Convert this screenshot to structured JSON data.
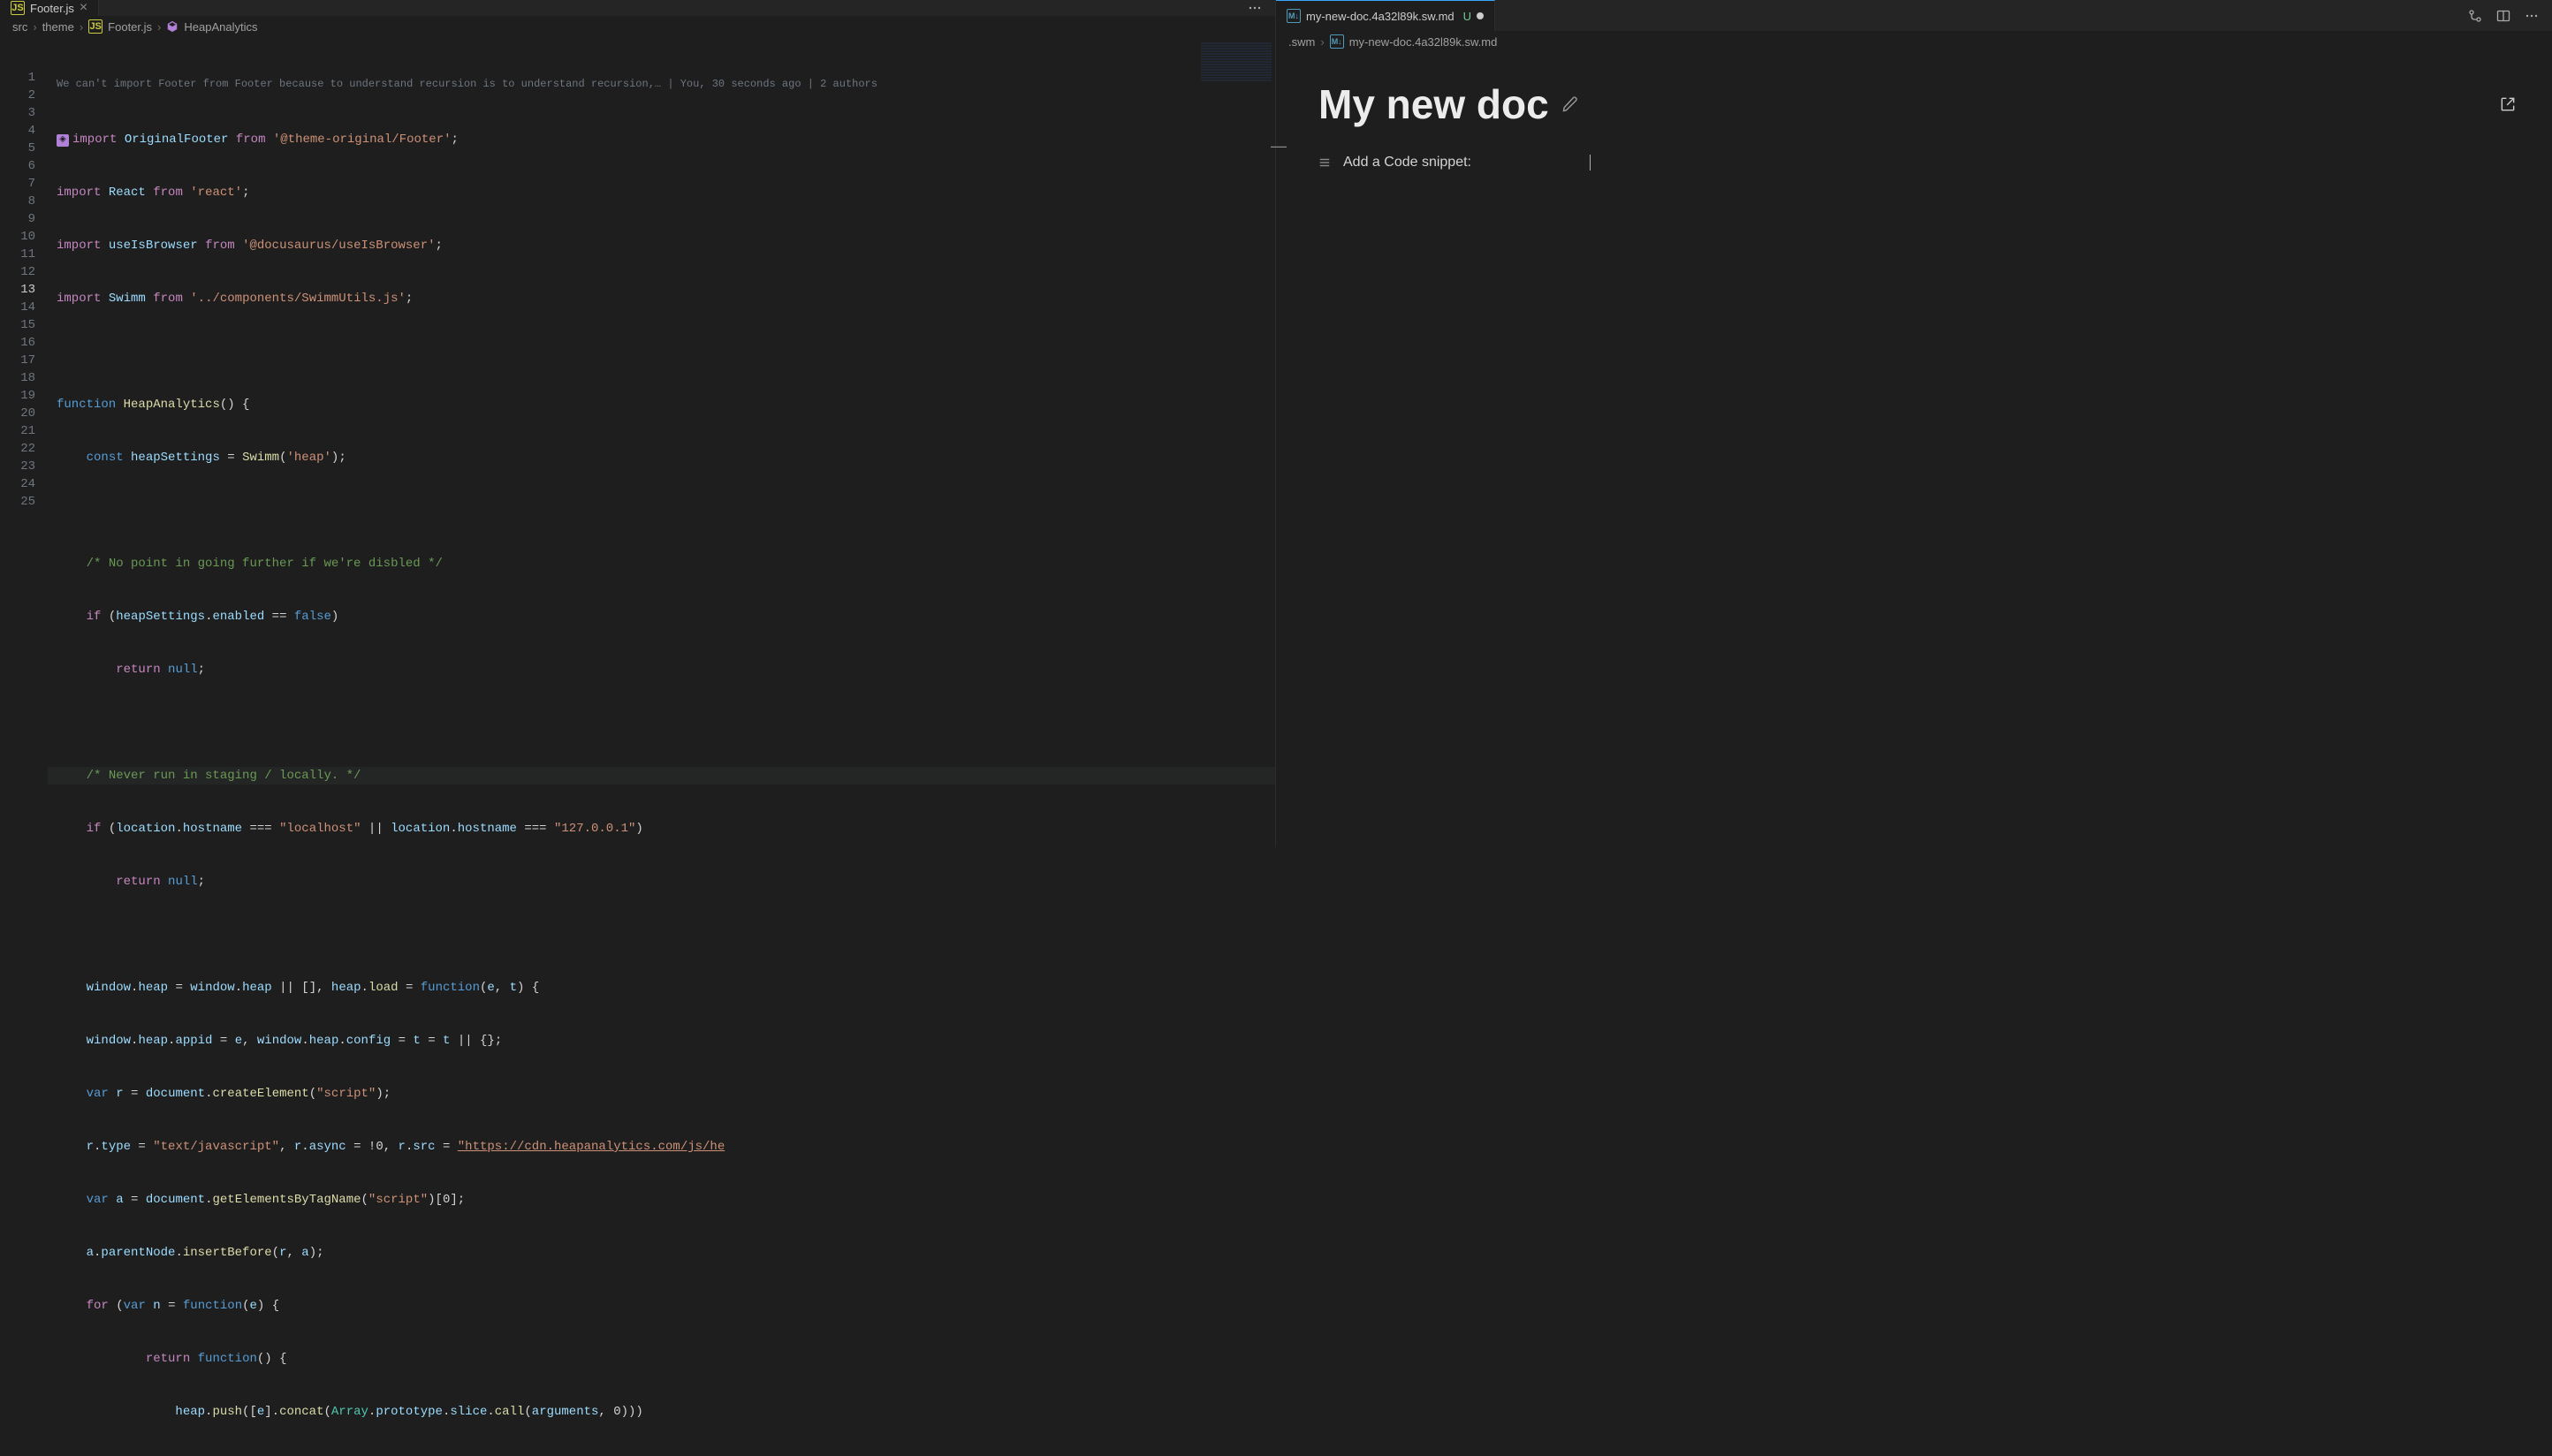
{
  "leftPane": {
    "tab": {
      "icon": "JS",
      "label": "Footer.js"
    },
    "breadcrumbs": {
      "parts": [
        "src",
        "theme"
      ],
      "fileIcon": "JS",
      "file": "Footer.js",
      "symbol": "HeapAnalytics"
    },
    "codelens": "We can't import Footer from Footer because to understand recursion is to understand recursion,… | You, 30 seconds ago | 2 authors",
    "currentLine": 13,
    "lines": 25
  },
  "rightPane": {
    "tab": {
      "icon": "M↓",
      "label": "my-new-doc.4a32l89k.sw.md",
      "u": "U"
    },
    "breadcrumbs": {
      "folder": ".swm",
      "fileIcon": "M↓",
      "file": "my-new-doc.4a32l89k.sw.md"
    },
    "doc": {
      "title": "My new doc",
      "blockText": "Add a Code snippet:"
    }
  },
  "code": {
    "l1": {
      "kw1": "import",
      "v": "OriginalFooter",
      "kw2": "from",
      "s": "'@theme-original/Footer'",
      "t": ";"
    },
    "l2": {
      "kw1": "import",
      "v": "React",
      "kw2": "from",
      "s": "'react'",
      "t": ";"
    },
    "l3": {
      "kw1": "import",
      "v": "useIsBrowser",
      "kw2": "from",
      "s": "'@docusaurus/useIsBrowser'",
      "t": ";"
    },
    "l4": {
      "kw1": "import",
      "v": "Swimm",
      "kw2": "from",
      "s": "'../components/SwimmUtils.js'",
      "t": ";"
    },
    "l6": {
      "kw": "function",
      "fn": "HeapAnalytics",
      "t": "() {"
    },
    "l7": {
      "kw": "const",
      "v": "heapSettings",
      "t1": " = ",
      "fn": "Swimm",
      "t2": "(",
      "s": "'heap'",
      "t3": ");"
    },
    "l9": "/* No point in going further if we're disbled */",
    "l10": {
      "kw": "if",
      "t1": " (",
      "v1": "heapSettings",
      "t2": ".",
      "v2": "enabled",
      "t3": " == ",
      "c": "false",
      "t4": ")"
    },
    "l11": {
      "kw": "return",
      "c": "null",
      "t": ";"
    },
    "l13": "/* Never run in staging / locally. */",
    "l14": {
      "kw": "if",
      "t1": " (",
      "v1": "location",
      "t2": ".",
      "v2": "hostname",
      "t3": " === ",
      "s1": "\"localhost\"",
      "t4": " || ",
      "v3": "location",
      "t5": ".",
      "v4": "hostname",
      "t6": " === ",
      "s2": "\"127.0.0.1\"",
      "t7": ")"
    },
    "l15": {
      "kw": "return",
      "c": "null",
      "t": ";"
    },
    "l17": {
      "v1": "window",
      "t1": ".",
      "v2": "heap",
      "t2": " = ",
      "v3": "window",
      "t3": ".",
      "v4": "heap",
      "t4": " || [], ",
      "v5": "heap",
      "t5": ".",
      "fn": "load",
      "t6": " = ",
      "kw": "function",
      "t7": "(",
      "v6": "e",
      "t8": ", ",
      "v7": "t",
      "t9": ") {"
    },
    "l18": {
      "v1": "window",
      "t1": ".",
      "v2": "heap",
      "t2": ".",
      "v3": "appid",
      "t3": " = ",
      "v4": "e",
      "t4": ", ",
      "v5": "window",
      "t5": ".",
      "v6": "heap",
      "t6": ".",
      "v7": "config",
      "t7": " = ",
      "v8": "t",
      "t8": " = ",
      "v9": "t",
      "t9": " || {};"
    },
    "l19": {
      "kw": "var",
      "v": "r",
      "t1": " = ",
      "v2": "document",
      "t2": ".",
      "fn": "createElement",
      "t3": "(",
      "s": "\"script\"",
      "t4": ");"
    },
    "l20": {
      "v1": "r",
      "t1": ".",
      "v2": "type",
      "t2": " = ",
      "s1": "\"text/javascript\"",
      "t3": ", ",
      "v3": "r",
      "t4": ".",
      "v4": "async",
      "t5": " = !0, ",
      "v5": "r",
      "t6": ".",
      "v6": "src",
      "t7": " = ",
      "s2": "\"https://cdn.heapanalytics.com/js/he"
    },
    "l21": {
      "kw": "var",
      "v": "a",
      "t1": " = ",
      "v2": "document",
      "t2": ".",
      "fn": "getElementsByTagName",
      "t3": "(",
      "s": "\"script\"",
      "t4": ")[0];"
    },
    "l22": {
      "v1": "a",
      "t1": ".",
      "v2": "parentNode",
      "t2": ".",
      "fn": "insertBefore",
      "t3": "(",
      "v3": "r",
      "t4": ", ",
      "v4": "a",
      "t5": ");"
    },
    "l23": {
      "kw": "for",
      "t1": " (",
      "kw2": "var",
      "v": "n",
      "t2": " = ",
      "kw3": "function",
      "t3": "(",
      "v2": "e",
      "t4": ") {"
    },
    "l24": {
      "kw": "return",
      "kw2": "function",
      "t": "() {"
    },
    "l25": {
      "v1": "heap",
      "t1": ".",
      "fn": "push",
      "t2": "([",
      "v2": "e",
      "t3": "].",
      "fn2": "concat",
      "t4": "(",
      "ty": "Array",
      "t5": ".",
      "v3": "prototype",
      "t6": ".",
      "v4": "slice",
      "t7": ".",
      "fn3": "call",
      "t8": "(",
      "v5": "arguments",
      "t9": ", 0)))"
    }
  }
}
